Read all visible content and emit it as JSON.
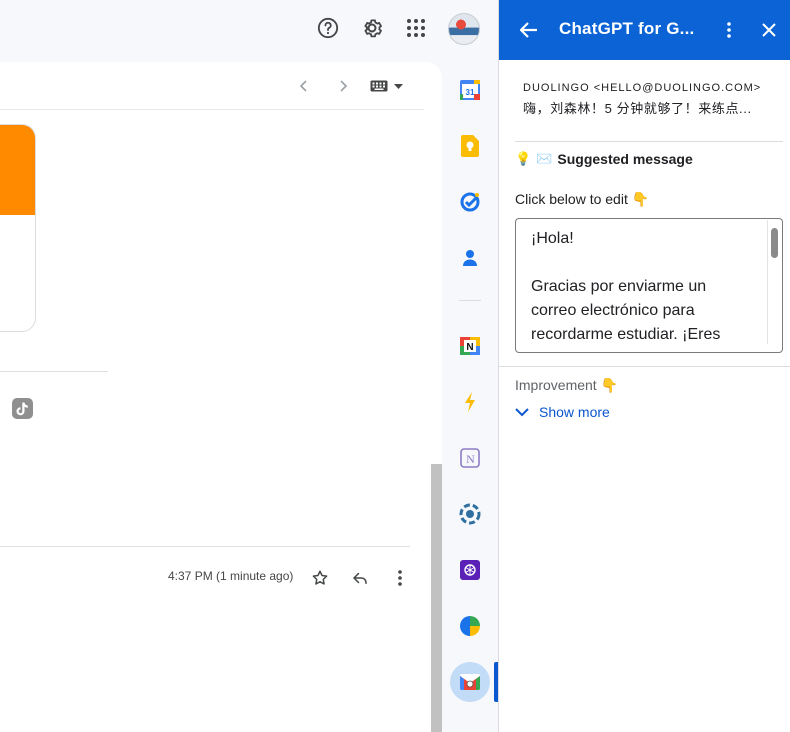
{
  "topbar": {
    "icons": [
      "help-icon",
      "settings-gear-icon",
      "apps-grid-icon",
      "account-avatar"
    ]
  },
  "mail": {
    "toolbar": {
      "icons": [
        "older-chevron-icon",
        "newer-chevron-icon",
        "keyboard-icon"
      ]
    },
    "timestamp": "4:37 PM (1 minute ago)",
    "brand_color": "#ff8a00"
  },
  "addons": {
    "items": [
      "Calendar",
      "Keep",
      "Tasks",
      "Contacts",
      "Notion",
      "Lightning",
      "Notion Outline",
      "Extension",
      "ChatGPT",
      "Pie",
      "ChatGPT for Gmail"
    ],
    "active": "ChatGPT for Gmail",
    "calendar_day": "31"
  },
  "gpt": {
    "title": "ChatGPT for G...",
    "header_color": "#0b63d6",
    "sender": "DUOLINGO <HELLO@DUOLINGO.COM>",
    "subject": "嗨，刘森林！5 分钟就够了！来练点...",
    "suggested_label": "Suggested message",
    "emoji_bulb": "💡",
    "emoji_mail": "✉️",
    "click_label": "Click below to edit",
    "emoji_point": "👇",
    "message": "¡Hola!\n\nGracias por enviarme un correo electrónico para recordarme estudiar. ¡Eres",
    "improvement_label": "Improvement",
    "show_more": "Show more"
  }
}
